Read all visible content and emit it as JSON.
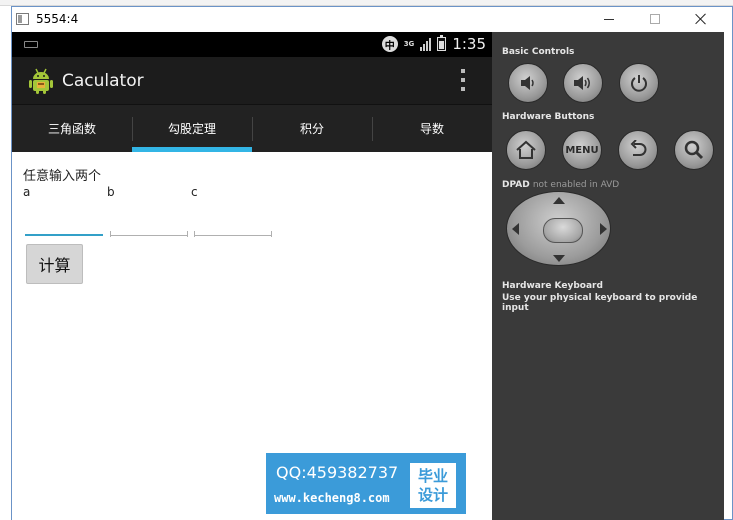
{
  "window": {
    "title": "5554:4",
    "min_label": "—",
    "max_label": "☐",
    "close_label": "✕"
  },
  "statusbar": {
    "ime": "中",
    "network": "3G",
    "time": "1:35"
  },
  "app": {
    "title": "Caculator",
    "tabs": [
      {
        "label": "三角函数",
        "active": false
      },
      {
        "label": "勾股定理",
        "active": true
      },
      {
        "label": "积分",
        "active": false
      },
      {
        "label": "导数",
        "active": false
      }
    ],
    "prompt": "任意输入两个",
    "labels": {
      "a": "a",
      "b": "b",
      "c": "c"
    },
    "fields": {
      "a": "",
      "b": "",
      "c": ""
    },
    "calc_button": "计算"
  },
  "watermark": {
    "qq": "QQ:459382737",
    "url": "www.kecheng8.com",
    "box_line1": "毕业",
    "box_line2": "设计"
  },
  "controls": {
    "basic_title": "Basic Controls",
    "hardware_title": "Hardware Buttons",
    "menu_label": "MENU",
    "dpad_title": "DPAD",
    "dpad_note": "not enabled in AVD",
    "keyboard_title": "Hardware Keyboard",
    "keyboard_note": "Use your physical keyboard to provide input"
  },
  "colors": {
    "tab_indicator": "#33b5e5",
    "focused_field": "#33a0c8",
    "watermark_bg": "#3b9bd9",
    "emulator_panel": "#3a3a3a"
  }
}
